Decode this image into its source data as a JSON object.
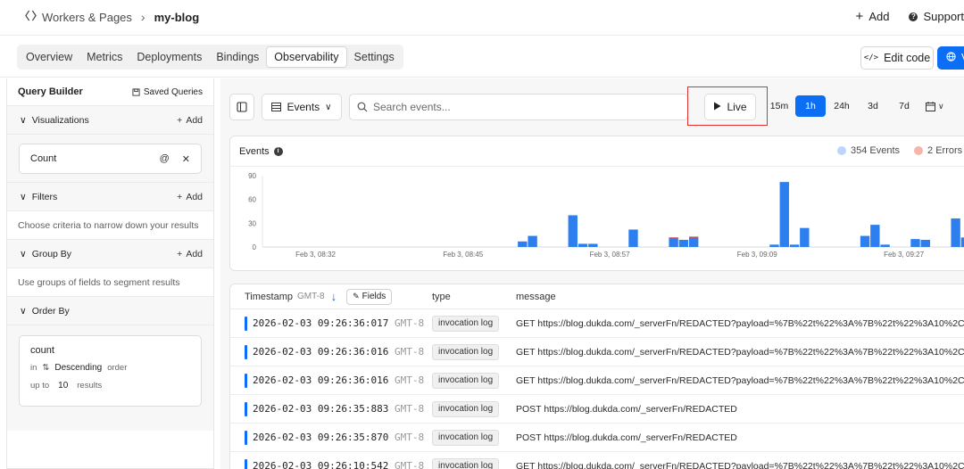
{
  "topbar": {
    "workers_label": "Workers & Pages",
    "project": "my-blog",
    "add_label": "Add",
    "support_label": "Support"
  },
  "tabs": [
    "Overview",
    "Metrics",
    "Deployments",
    "Bindings",
    "Observability",
    "Settings"
  ],
  "active_tab": "Observability",
  "header_actions": {
    "edit_code": "Edit code",
    "visit": "V"
  },
  "sidebar": {
    "title": "Query Builder",
    "saved_queries": "Saved Queries",
    "visualizations": {
      "label": "Visualizations",
      "add": "Add",
      "item": "Count"
    },
    "filters": {
      "label": "Filters",
      "add": "Add",
      "help": "Choose criteria to narrow down your results"
    },
    "group_by": {
      "label": "Group By",
      "add": "Add",
      "help": "Use groups of fields to segment results"
    },
    "order_by": {
      "label": "Order By",
      "field": "count",
      "in_label": "in",
      "direction": "Descending",
      "order_label": "order",
      "up_to_label": "up to",
      "limit": "10",
      "results_label": "results"
    }
  },
  "toolbar": {
    "events_label": "Events",
    "search_placeholder": "Search events...",
    "live_label": "Live",
    "ranges": [
      "15m",
      "1h",
      "24h",
      "3d",
      "7d"
    ],
    "active_range": "1h"
  },
  "chart": {
    "title": "Events",
    "legend_events": "354 Events",
    "legend_errors": "2 Errors",
    "colors": {
      "events": "#2d7ff0",
      "errors": "#e04b3c",
      "events_legend": "#bcd6fb",
      "errors_legend": "#f5b5ab"
    }
  },
  "chart_data": {
    "type": "bar",
    "title": "Events",
    "ylim": [
      0,
      90
    ],
    "yticks": [
      0,
      30,
      60,
      90
    ],
    "xtick_labels": [
      "Feb 3, 08:32",
      "Feb 3, 08:45",
      "Feb 3, 08:57",
      "Feb 3, 09:09",
      "Feb 3, 09:27"
    ],
    "series": [
      {
        "name": "354 Events",
        "values": [
          0,
          0,
          0,
          0,
          0,
          0,
          0,
          0,
          0,
          0,
          0,
          0,
          0,
          0,
          0,
          0,
          0,
          0,
          0,
          0,
          0,
          0,
          0,
          0,
          0,
          7,
          14,
          0,
          0,
          0,
          40,
          4,
          4,
          0,
          0,
          0,
          22,
          0,
          0,
          0,
          12,
          9,
          13,
          0,
          0,
          0,
          0,
          0,
          0,
          0,
          3,
          82,
          3,
          24,
          0,
          0,
          0,
          0,
          0,
          14,
          28,
          3,
          0,
          0,
          10,
          9,
          0,
          0,
          36,
          12
        ]
      },
      {
        "name": "2 Errors",
        "values": [
          0,
          0,
          0,
          0,
          0,
          0,
          0,
          0,
          0,
          0,
          0,
          0,
          0,
          0,
          0,
          0,
          0,
          0,
          0,
          0,
          0,
          0,
          0,
          0,
          0,
          0,
          0,
          0,
          0,
          0,
          0,
          0,
          0,
          0,
          0,
          0,
          0,
          0,
          0,
          0,
          4,
          0,
          4,
          0,
          0,
          0,
          0,
          0,
          0,
          0,
          0,
          0,
          0,
          0,
          0,
          0,
          0,
          0,
          0,
          0,
          0,
          0,
          0,
          0,
          0,
          0,
          0,
          0,
          0,
          0
        ]
      }
    ],
    "grid": false,
    "legend": "top-right"
  },
  "table": {
    "col_timestamp": "Timestamp",
    "col_timestamp_tz": "GMT-8",
    "fields_label": "Fields",
    "col_type": "type",
    "col_message": "message",
    "rows": [
      {
        "ts": "2026-02-03 09:26:36:017",
        "tz": "GMT-8",
        "type": "invocation log",
        "message": "GET https://blog.dukda.com/_serverFn/REDACTED?payload=%7B%22t%22%3A%7B%22t%22%3A10%2C"
      },
      {
        "ts": "2026-02-03 09:26:36:016",
        "tz": "GMT-8",
        "type": "invocation log",
        "message": "GET https://blog.dukda.com/_serverFn/REDACTED?payload=%7B%22t%22%3A%7B%22t%22%3A10%2C"
      },
      {
        "ts": "2026-02-03 09:26:36:016",
        "tz": "GMT-8",
        "type": "invocation log",
        "message": "GET https://blog.dukda.com/_serverFn/REDACTED?payload=%7B%22t%22%3A%7B%22t%22%3A10%2C"
      },
      {
        "ts": "2026-02-03 09:26:35:883",
        "tz": "GMT-8",
        "type": "invocation log",
        "message": "POST https://blog.dukda.com/_serverFn/REDACTED"
      },
      {
        "ts": "2026-02-03 09:26:35:870",
        "tz": "GMT-8",
        "type": "invocation log",
        "message": "POST https://blog.dukda.com/_serverFn/REDACTED"
      },
      {
        "ts": "2026-02-03 09:26:10:542",
        "tz": "GMT-8",
        "type": "invocation log",
        "message": "GET https://blog.dukda.com/_serverFn/REDACTED?payload=%7B%22t%22%3A%7B%22t%22%3A10%2C"
      }
    ]
  }
}
